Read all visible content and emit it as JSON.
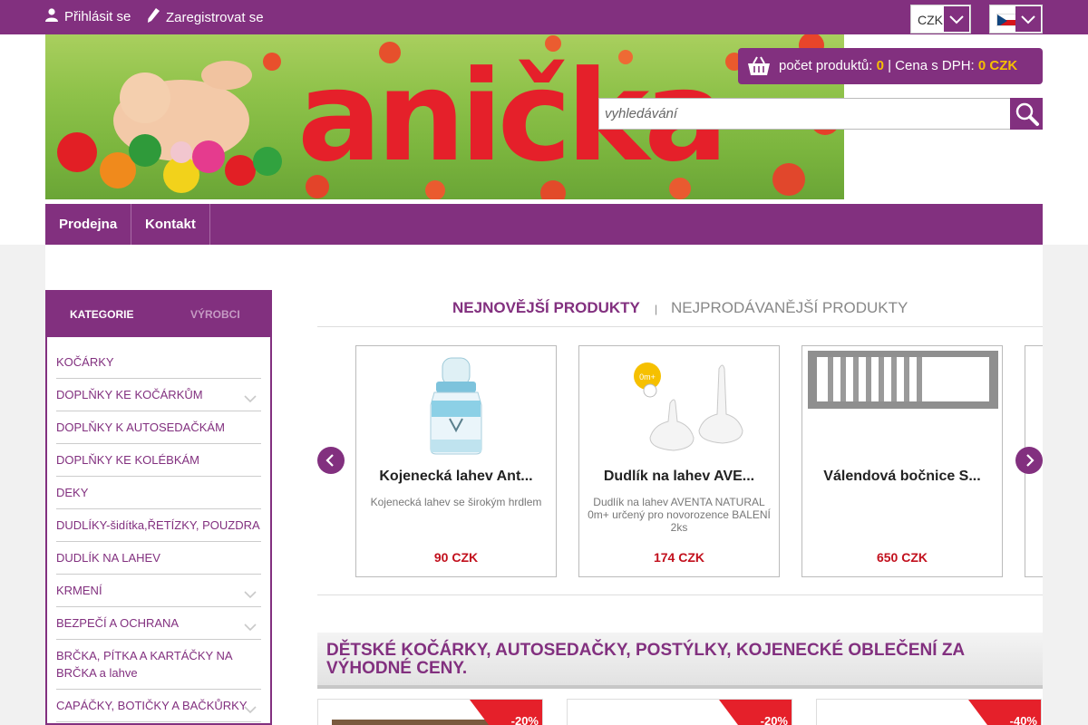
{
  "topbar": {
    "login_label": "Přihlásit se",
    "register_label": "Zaregistrovat se",
    "currency": "CZK",
    "language_flag": "czech-flag-icon"
  },
  "header": {
    "logo_text": "anička",
    "cart": {
      "count_label": "počet produktů:",
      "count_value": "0",
      "separator": "|",
      "price_label": "Cena s DPH:",
      "price_value": "0 CZK"
    },
    "search_placeholder": "vyhledávání"
  },
  "nav": {
    "items": [
      {
        "label": "Prodejna"
      },
      {
        "label": "Kontakt"
      }
    ]
  },
  "sidebar": {
    "tabs": {
      "active": "KATEGORIE",
      "inactive": "VÝROBCI"
    },
    "items": [
      {
        "label": "KOČÁRKY",
        "expandable": false
      },
      {
        "label": "DOPLŇKY KE KOČÁRKŮM",
        "expandable": true
      },
      {
        "label": "DOPLŇKY K AUTOSEDAČKÁM",
        "expandable": false
      },
      {
        "label": "DOPLŇKY KE KOLÉBKÁM",
        "expandable": false
      },
      {
        "label": "DEKY",
        "expandable": false
      },
      {
        "label": "DUDLÍKY-šidítka,ŘETÍZKY, POUZDRA",
        "expandable": false
      },
      {
        "label": "DUDLÍK NA LAHEV",
        "expandable": false
      },
      {
        "label": "KRMENÍ",
        "expandable": true
      },
      {
        "label": "BEZPEČÍ A OCHRANA",
        "expandable": true
      },
      {
        "label": "BRČKA, PÍTKA A KARTÁČKY NA BRČKA a lahve",
        "expandable": false
      },
      {
        "label": "CAPÁČKY, BOTIČKY A BAČKŮRKY",
        "expandable": true
      }
    ]
  },
  "products_tabs": {
    "active": "NEJNOVĚJŠÍ PRODUKTY",
    "separator": "|",
    "inactive": "NEJPRODÁVANĚJŠÍ PRODUKTY"
  },
  "products": [
    {
      "title": "Kojenecká lahev Ant...",
      "desc": "Kojenecká lahev se širokým hrdlem",
      "price": "90 CZK"
    },
    {
      "title": "Dudlík na lahev AVE...",
      "desc": "Dudlík na lahev AVENTA NATURAL 0m+ určený pro novorozence BALENÍ 2ks",
      "price": "174 CZK",
      "badge": "0m+"
    },
    {
      "title": "Válendová bočnice S...",
      "desc": "",
      "price": "650 CZK"
    }
  ],
  "promo": {
    "title": "DĚTSKÉ KOČÁRKY, AUTOSEDAČKY, POSTÝLKY, KOJENECKÉ OBLEČENÍ ZA VÝHODNÉ CENY."
  },
  "discount_cards": [
    {
      "discount": "-20%"
    },
    {
      "discount": "-20%"
    },
    {
      "discount": "-40%"
    }
  ],
  "colors": {
    "brand": "#82307f",
    "price": "#c2101d",
    "highlight": "#f6c000",
    "discount": "#e5202a"
  }
}
